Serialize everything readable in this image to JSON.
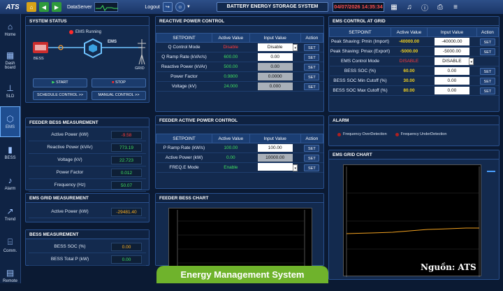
{
  "topbar": {
    "logo": "ATS",
    "dataserver_label": "DataServer",
    "logout_label": "Logout",
    "app_title": "BATTERY ENERGY STORAGE SYSTEM",
    "clock": "04/07/2026 14:35:34"
  },
  "sidebar": [
    {
      "label": "Home",
      "icon": "home-icon",
      "glyph": "⌂"
    },
    {
      "label": "Dash board",
      "icon": "dashboard-icon",
      "glyph": "▦"
    },
    {
      "label": "SLD",
      "icon": "sld-icon",
      "glyph": "⊥"
    },
    {
      "label": "EMS",
      "icon": "ems-icon",
      "glyph": "⬡"
    },
    {
      "label": "BESS",
      "icon": "battery-icon",
      "glyph": "▮"
    },
    {
      "label": "Alarm",
      "icon": "bell-icon",
      "glyph": "♪"
    },
    {
      "label": "Trend",
      "icon": "trend-icon",
      "glyph": "↗"
    },
    {
      "label": "Comm.",
      "icon": "network-icon",
      "glyph": "⌸"
    },
    {
      "label": "Remote",
      "icon": "remote-icon",
      "glyph": "▤"
    }
  ],
  "system_status": {
    "title": "SYSTEM STATUS",
    "ems_status": "EMS Running",
    "bess": "BESS",
    "ems": "EMS",
    "grid": "GRID",
    "start": "START",
    "stop": "STOP",
    "schedule": "SCHEDULE CONTROL >>",
    "manual": "MANUAL CONTROL >>"
  },
  "feeder_bess": {
    "title": "FEEDER BESS MEASUREMENT",
    "rows": [
      {
        "label": "Active Power (kW)",
        "value": "-9.58",
        "cls": "val-r"
      },
      {
        "label": "Reactive Power (kVAr)",
        "value": "773.19",
        "cls": "val-g"
      },
      {
        "label": "Voltage (kV)",
        "value": "22.723",
        "cls": "val-g"
      },
      {
        "label": "Power Factor",
        "value": "0.012",
        "cls": "val-g"
      },
      {
        "label": "Frequency (Hz)",
        "value": "50.07",
        "cls": "val-g"
      }
    ]
  },
  "ems_grid": {
    "title": "EMS GRID MEASUREMENT",
    "rows": [
      {
        "label": "Active Power (kW)",
        "value": "-29481.40",
        "cls": "val-o"
      }
    ]
  },
  "bess_meas": {
    "title": "BESS MEASUREMENT",
    "rows": [
      {
        "label": "BESS SOC (%)",
        "value": "0.00",
        "cls": "val-o"
      },
      {
        "label": "BESS Total P (kW)",
        "value": "0.00",
        "cls": "val-g"
      }
    ]
  },
  "reactive": {
    "title": "REACTIVE POWER CONTROL",
    "headers": [
      "SETPOINT",
      "Active Value",
      "Input Value",
      "Action"
    ],
    "rows": [
      {
        "label": "Q Control Mode",
        "active": "Disable",
        "acls": "val-r",
        "input": "Disable",
        "grey": false,
        "dropdown": true,
        "action": "SET"
      },
      {
        "label": "Q Ramp Rate (kVAr/s)",
        "active": "600.00",
        "acls": "val-g",
        "input": "0.00",
        "grey": false,
        "dropdown": false,
        "action": "SET"
      },
      {
        "label": "Reactive Power (kVAr)",
        "active": "500.00",
        "acls": "val-g",
        "input": "0.00",
        "grey": true,
        "dropdown": false,
        "action": "SET"
      },
      {
        "label": "Power Factor",
        "active": "0.9800",
        "acls": "val-g",
        "input": "0.0000",
        "grey": true,
        "dropdown": false,
        "action": "SET"
      },
      {
        "label": "Voltage (kV)",
        "active": "24.000",
        "acls": "val-g",
        "input": "0.000",
        "grey": true,
        "dropdown": false,
        "action": "SET"
      }
    ]
  },
  "feeder_active": {
    "title": "FEEDER ACTIVE POWER CONTROL",
    "headers": [
      "SETPOINT",
      "Active Value",
      "Input Value",
      "Action"
    ],
    "rows": [
      {
        "label": "P Ramp Rate (kW/s)",
        "active": "100.00",
        "acls": "val-g",
        "input": "100.00",
        "grey": false,
        "dropdown": false,
        "action": "SET"
      },
      {
        "label": "Active Power (kW)",
        "active": "0.00",
        "acls": "val-g",
        "input": "10000.00",
        "grey": true,
        "dropdown": false,
        "action": "SET"
      },
      {
        "label": "FREQ.E Mode",
        "active": "Enable",
        "acls": "val-g",
        "input": "",
        "grey": false,
        "dropdown": true,
        "action": "SET"
      }
    ]
  },
  "ems_control": {
    "title": "EMS CONTROL AT GRID",
    "headers": [
      "SETPOINT",
      "Active Value",
      "Input Value",
      "Action"
    ],
    "rows": [
      {
        "label": "Peak Shaving: Pmin (Import)",
        "active": "-40000.00",
        "acls": "val-y",
        "input": "-40000.00",
        "grey": false,
        "dropdown": false,
        "action": "SET"
      },
      {
        "label": "Peak Shaving: Pmax (Export)",
        "active": "-5000.00",
        "acls": "val-y",
        "input": "-5000.00",
        "grey": false,
        "dropdown": false,
        "action": "SET"
      },
      {
        "label": "EMS Control Mode",
        "active": "DISABLE",
        "acls": "val-r",
        "input": "DISABLE",
        "grey": false,
        "dropdown": true,
        "action": ""
      },
      {
        "label": "BESS SOC (%)",
        "active": "60.00",
        "acls": "val-y",
        "input": "0.00",
        "grey": false,
        "dropdown": false,
        "action": "SET"
      },
      {
        "label": "BESS SOC Min Cutoff (%)",
        "active": "30.00",
        "acls": "val-y",
        "input": "0.00",
        "grey": false,
        "dropdown": false,
        "action": "SET"
      },
      {
        "label": "BESS SOC Max Cutoff (%)",
        "active": "80.00",
        "acls": "val-y",
        "input": "0.00",
        "grey": false,
        "dropdown": false,
        "action": "SET"
      }
    ]
  },
  "alarm": {
    "title": "ALARM",
    "items": [
      "Frequency OverDetection",
      "Frequency UnderDetection"
    ]
  },
  "feeder_chart": {
    "title": "FEEDER BESS CHART"
  },
  "grid_chart": {
    "title": "EMS GRID CHART"
  },
  "banner": "Energy Management System",
  "source": "Nguồn: ATS"
}
